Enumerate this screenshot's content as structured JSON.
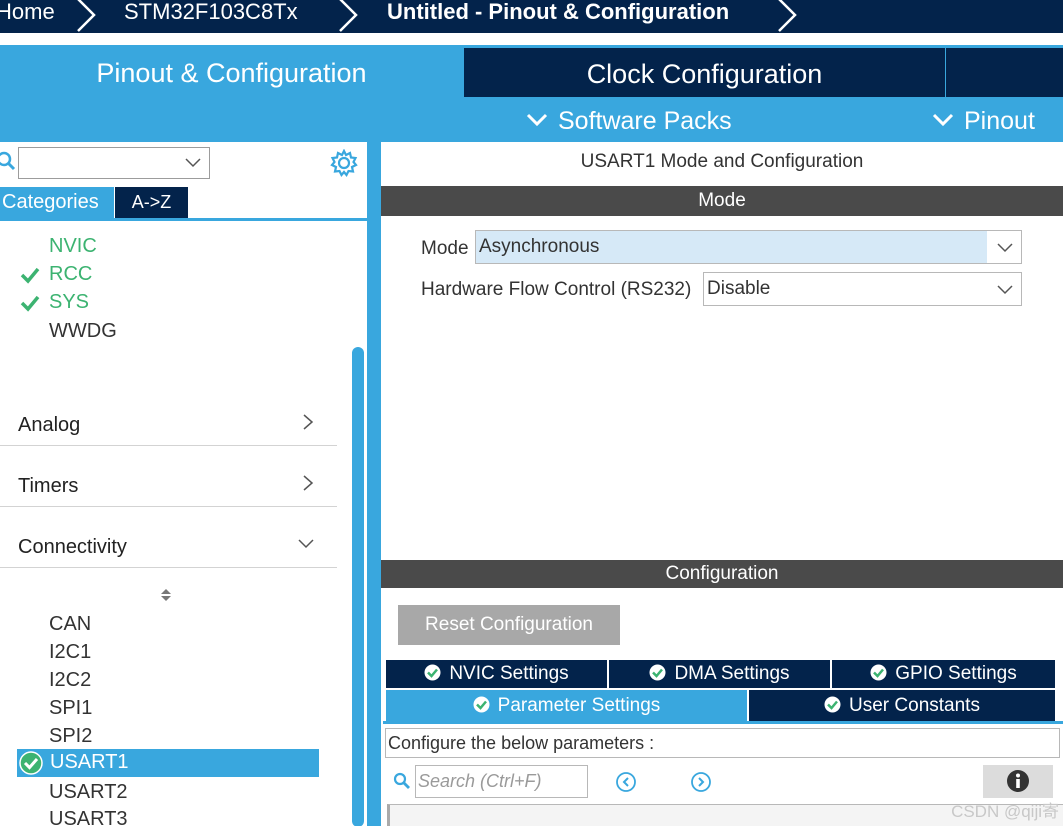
{
  "breadcrumb": {
    "items": [
      "Home",
      "STM32F103C8Tx",
      "Untitled - Pinout & Configuration"
    ]
  },
  "main_tabs": {
    "pinout": "Pinout & Configuration",
    "clock": "Clock Configuration"
  },
  "sub_tabs": {
    "software_packs": "Software Packs",
    "pinout": "Pinout"
  },
  "left": {
    "search_value": "",
    "category_tabs": [
      "Categories",
      "A->Z"
    ],
    "system_core_items": [
      {
        "label": "NVIC",
        "checked": false,
        "color": "#3cb371"
      },
      {
        "label": "RCC",
        "checked": true,
        "color": "#3cb371"
      },
      {
        "label": "SYS",
        "checked": true,
        "color": "#3cb371"
      },
      {
        "label": "WWDG",
        "checked": false,
        "color": "#333333"
      }
    ],
    "groups": [
      {
        "label": "Analog",
        "expanded": false
      },
      {
        "label": "Timers",
        "expanded": false
      },
      {
        "label": "Connectivity",
        "expanded": true
      }
    ],
    "connectivity_items": [
      "CAN",
      "I2C1",
      "I2C2",
      "SPI1",
      "SPI2",
      "USART1",
      "USART2",
      "USART3"
    ],
    "selected_item": "USART1"
  },
  "right": {
    "panel_title": "USART1 Mode and Configuration",
    "mode_header": "Mode",
    "mode_label": "Mode",
    "mode_value": "Asynchronous",
    "flow_label": "Hardware Flow Control (RS232)",
    "flow_value": "Disable",
    "config_header": "Configuration",
    "reset_button": "Reset Configuration",
    "settings_tabs_row1": [
      "NVIC Settings",
      "DMA Settings",
      "GPIO Settings"
    ],
    "settings_tabs_row2": [
      "Parameter Settings",
      "User Constants"
    ],
    "active_tab": "Parameter Settings",
    "config_note": "Configure the below parameters :",
    "search_placeholder": "Search (Ctrl+F)"
  },
  "watermark": "CSDN @qiji寄",
  "colors": {
    "navy": "#03234b",
    "accent_blue": "#39a7de",
    "header_gray": "#4a4a4a",
    "green": "#3cb371",
    "highlight": "#d6e9f7"
  }
}
